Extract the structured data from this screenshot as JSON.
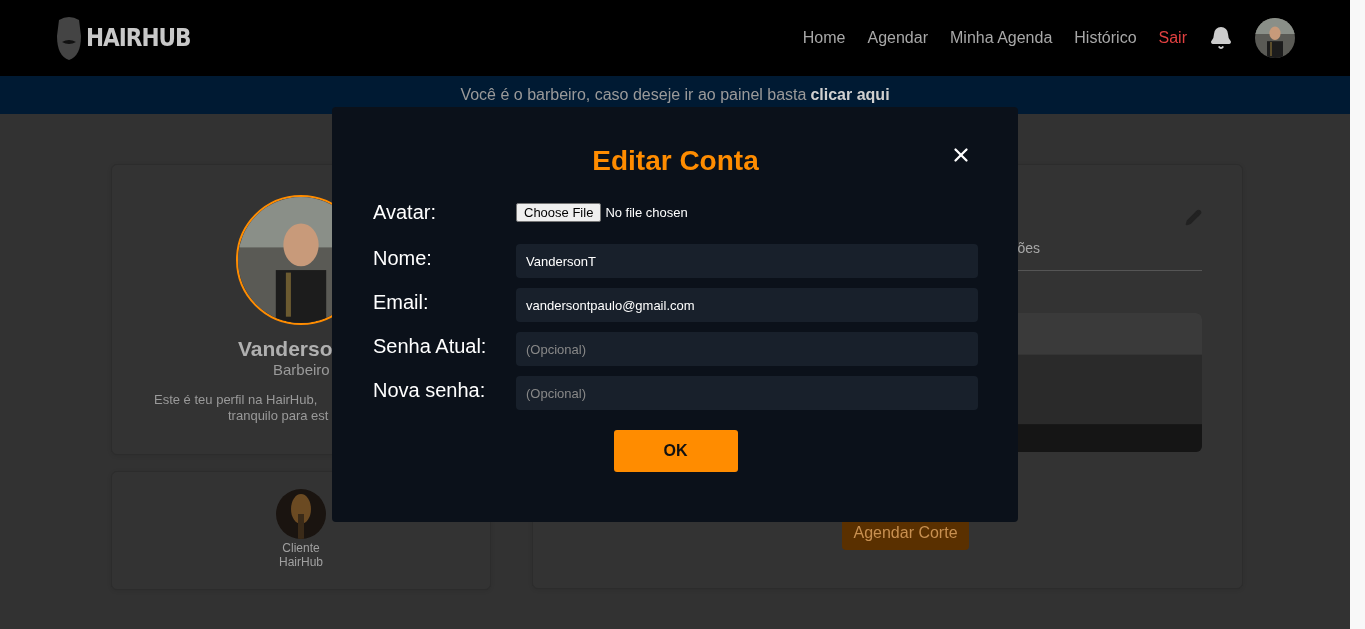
{
  "navbar": {
    "logo": "HAIRHUB",
    "links": [
      {
        "label": "Home",
        "kind": "link"
      },
      {
        "label": "Agendar",
        "kind": "link"
      },
      {
        "label": "Minha Agenda",
        "kind": "link"
      },
      {
        "label": "Histórico",
        "kind": "link"
      },
      {
        "label": "Sair",
        "kind": "logout"
      }
    ]
  },
  "banner": {
    "text": "Você é o barbeiro, caso deseje ir ao painel basta",
    "link": "clicar aqui"
  },
  "profile_card": {
    "name": "Vanderso",
    "role": "Barbeiro",
    "description_lines": [
      "Este é teu perfil na HairHub,",
      "tranquilo para est"
    ]
  },
  "client_card": {
    "lines": [
      "Cliente",
      "HairHub"
    ]
  },
  "main_card": {
    "tab_fragment": "ões",
    "button": "Agendar Corte"
  },
  "modal": {
    "title": "Editar Conta",
    "fields": [
      {
        "label": "Avatar:",
        "kind": "file",
        "button": "Choose File",
        "status": "No file chosen"
      },
      {
        "label": "Nome:",
        "kind": "text",
        "value": "VandersonT"
      },
      {
        "label": "Email:",
        "kind": "text",
        "value": "vandersontpaulo@gmail.com"
      },
      {
        "label": "Senha Atual:",
        "kind": "password",
        "placeholder": "(Opcional)"
      },
      {
        "label": "Nova senha:",
        "kind": "password",
        "placeholder": "(Opcional)"
      }
    ],
    "submit": "OK"
  }
}
